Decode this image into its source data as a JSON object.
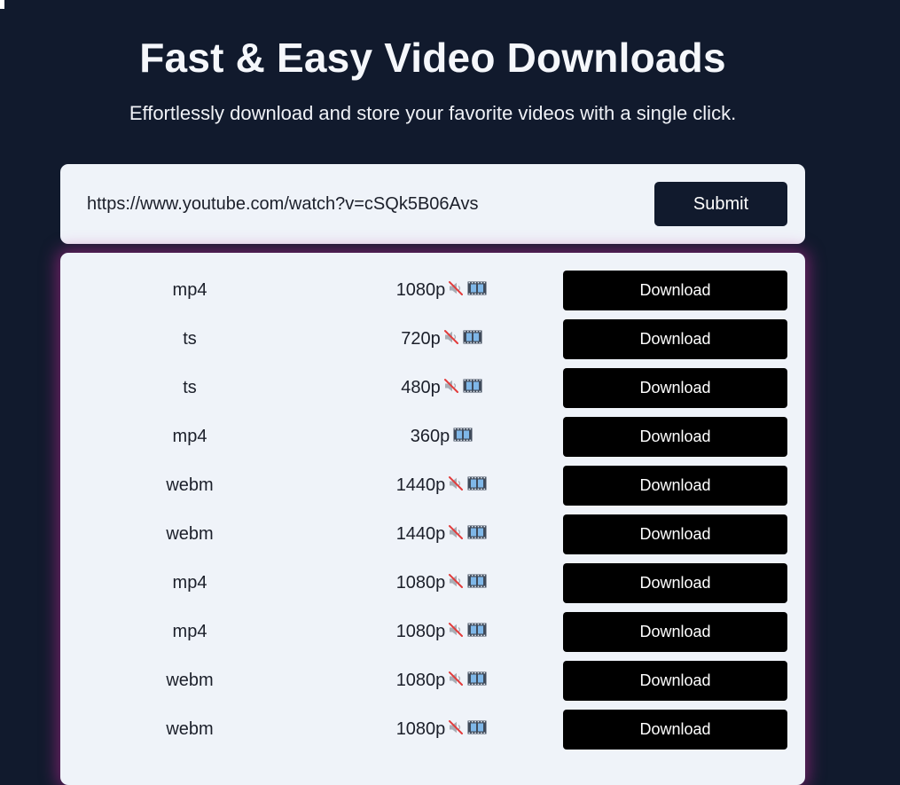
{
  "header": {
    "title": "Fast & Easy Video Downloads",
    "subtitle": "Effortlessly download and store your favorite videos with a single click."
  },
  "form": {
    "url_value": "https://www.youtube.com/watch?v=cSQk5B06Avs",
    "submit_label": "Submit"
  },
  "colors": {
    "background": "#111a2d",
    "panel": "#eff3f9",
    "download_button": "#000000",
    "glow": "#be2896"
  },
  "results": {
    "download_label": "Download",
    "rows": [
      {
        "format": "mp4",
        "quality": "1080p",
        "muted": true,
        "icons": [
          "muted-speaker-icon",
          "film-frames-icon"
        ]
      },
      {
        "format": "ts",
        "quality": "720p",
        "muted": true,
        "icons": [
          "muted-speaker-icon",
          "film-frames-icon"
        ]
      },
      {
        "format": "ts",
        "quality": "480p",
        "muted": true,
        "icons": [
          "muted-speaker-icon",
          "film-frames-icon"
        ]
      },
      {
        "format": "mp4",
        "quality": "360p",
        "muted": false,
        "icons": [
          "film-frames-icon"
        ]
      },
      {
        "format": "webm",
        "quality": "1440p",
        "muted": true,
        "icons": [
          "muted-speaker-icon",
          "film-frames-icon"
        ]
      },
      {
        "format": "webm",
        "quality": "1440p",
        "muted": true,
        "icons": [
          "muted-speaker-icon",
          "film-frames-icon"
        ]
      },
      {
        "format": "mp4",
        "quality": "1080p",
        "muted": true,
        "icons": [
          "muted-speaker-icon",
          "film-frames-icon"
        ]
      },
      {
        "format": "mp4",
        "quality": "1080p",
        "muted": true,
        "icons": [
          "muted-speaker-icon",
          "film-frames-icon"
        ]
      },
      {
        "format": "webm",
        "quality": "1080p",
        "muted": true,
        "icons": [
          "muted-speaker-icon",
          "film-frames-icon"
        ]
      },
      {
        "format": "webm",
        "quality": "1080p",
        "muted": true,
        "icons": [
          "muted-speaker-icon",
          "film-frames-icon"
        ]
      }
    ]
  }
}
